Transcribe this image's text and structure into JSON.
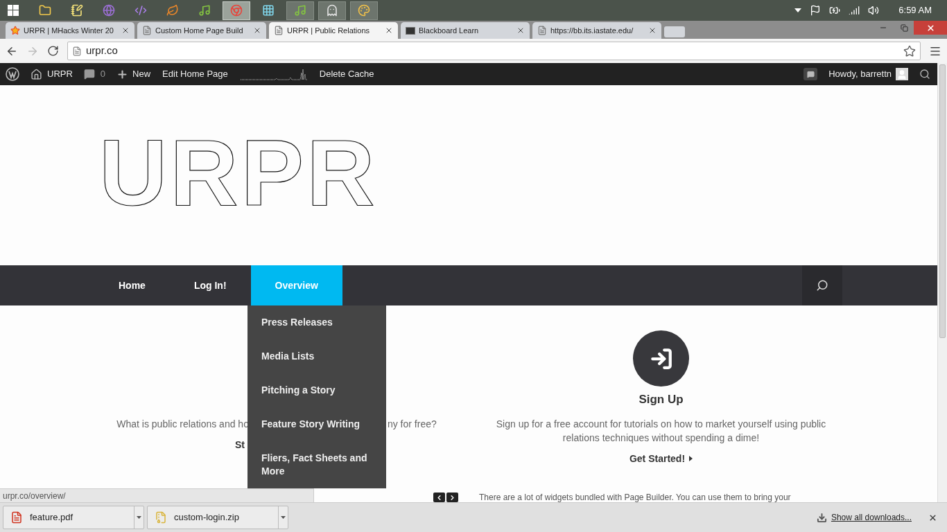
{
  "taskbar": {
    "apps": [
      {
        "kind": "windows",
        "running": false,
        "selected": false
      },
      {
        "kind": "folder",
        "running": false,
        "selected": false
      },
      {
        "kind": "notepad",
        "running": false,
        "selected": false
      },
      {
        "kind": "globe",
        "running": false,
        "selected": false
      },
      {
        "kind": "studio",
        "running": false,
        "selected": false
      },
      {
        "kind": "leaf",
        "running": false,
        "selected": false
      },
      {
        "kind": "music",
        "running": false,
        "selected": false
      },
      {
        "kind": "chrome",
        "running": true,
        "selected": true
      },
      {
        "kind": "grid",
        "running": false,
        "selected": false
      },
      {
        "kind": "music",
        "running": true,
        "selected": false
      },
      {
        "kind": "ghost",
        "running": true,
        "selected": false
      },
      {
        "kind": "palette",
        "running": true,
        "selected": false
      }
    ],
    "clock": "6:59 AM"
  },
  "browser": {
    "tabs": [
      {
        "title": "URPR | MHacks Winter 20",
        "kind": "star",
        "selected": false
      },
      {
        "title": "Custom Home Page Build",
        "kind": "page",
        "selected": false
      },
      {
        "title": "URPR | Public Relations",
        "kind": "page",
        "selected": true
      },
      {
        "title": "Blackboard Learn",
        "kind": "bb",
        "selected": false
      },
      {
        "title": "https://bb.its.iastate.edu/",
        "kind": "page",
        "selected": false
      }
    ],
    "address": "urpr.co"
  },
  "admin_bar": {
    "left": [
      {
        "kind": "wp-logo"
      },
      {
        "kind": "site",
        "label": "URPR"
      },
      {
        "kind": "comments",
        "label": "0"
      },
      {
        "kind": "new",
        "label": "New"
      },
      {
        "kind": "link",
        "label": "Edit Home Page"
      },
      {
        "kind": "graph"
      },
      {
        "kind": "link",
        "label": "Delete Cache"
      }
    ],
    "greeting": "Howdy, barrettn"
  },
  "site": {
    "logo": "URPR",
    "nav": [
      {
        "label": "Home",
        "selected": false
      },
      {
        "label": "Log In!",
        "selected": false
      },
      {
        "label": "Overview",
        "selected": true
      }
    ],
    "dropdown": [
      "Press Releases",
      "Media Lists",
      "Pitching a Story",
      "Feature Story Writing",
      "Fliers, Fact Sheets and More"
    ],
    "left_column": {
      "text_before": "What is public relations and ho",
      "text_after": "ny for free?",
      "link": "St"
    },
    "signup": {
      "title": "Sign Up",
      "text": "Sign up for a free account for tutorials on how to market yourself using public relations techniques without spending a dime!",
      "link": "Get Started!"
    },
    "widgets_text": "There are a lot of widgets bundled with Page Builder. You can use them to bring your"
  },
  "status_url": "urpr.co/overview/",
  "downloads": {
    "items": [
      {
        "name": "feature.pdf",
        "kind": "pdf"
      },
      {
        "name": "custom-login.zip",
        "kind": "zip"
      }
    ],
    "show_all": "Show all downloads..."
  }
}
